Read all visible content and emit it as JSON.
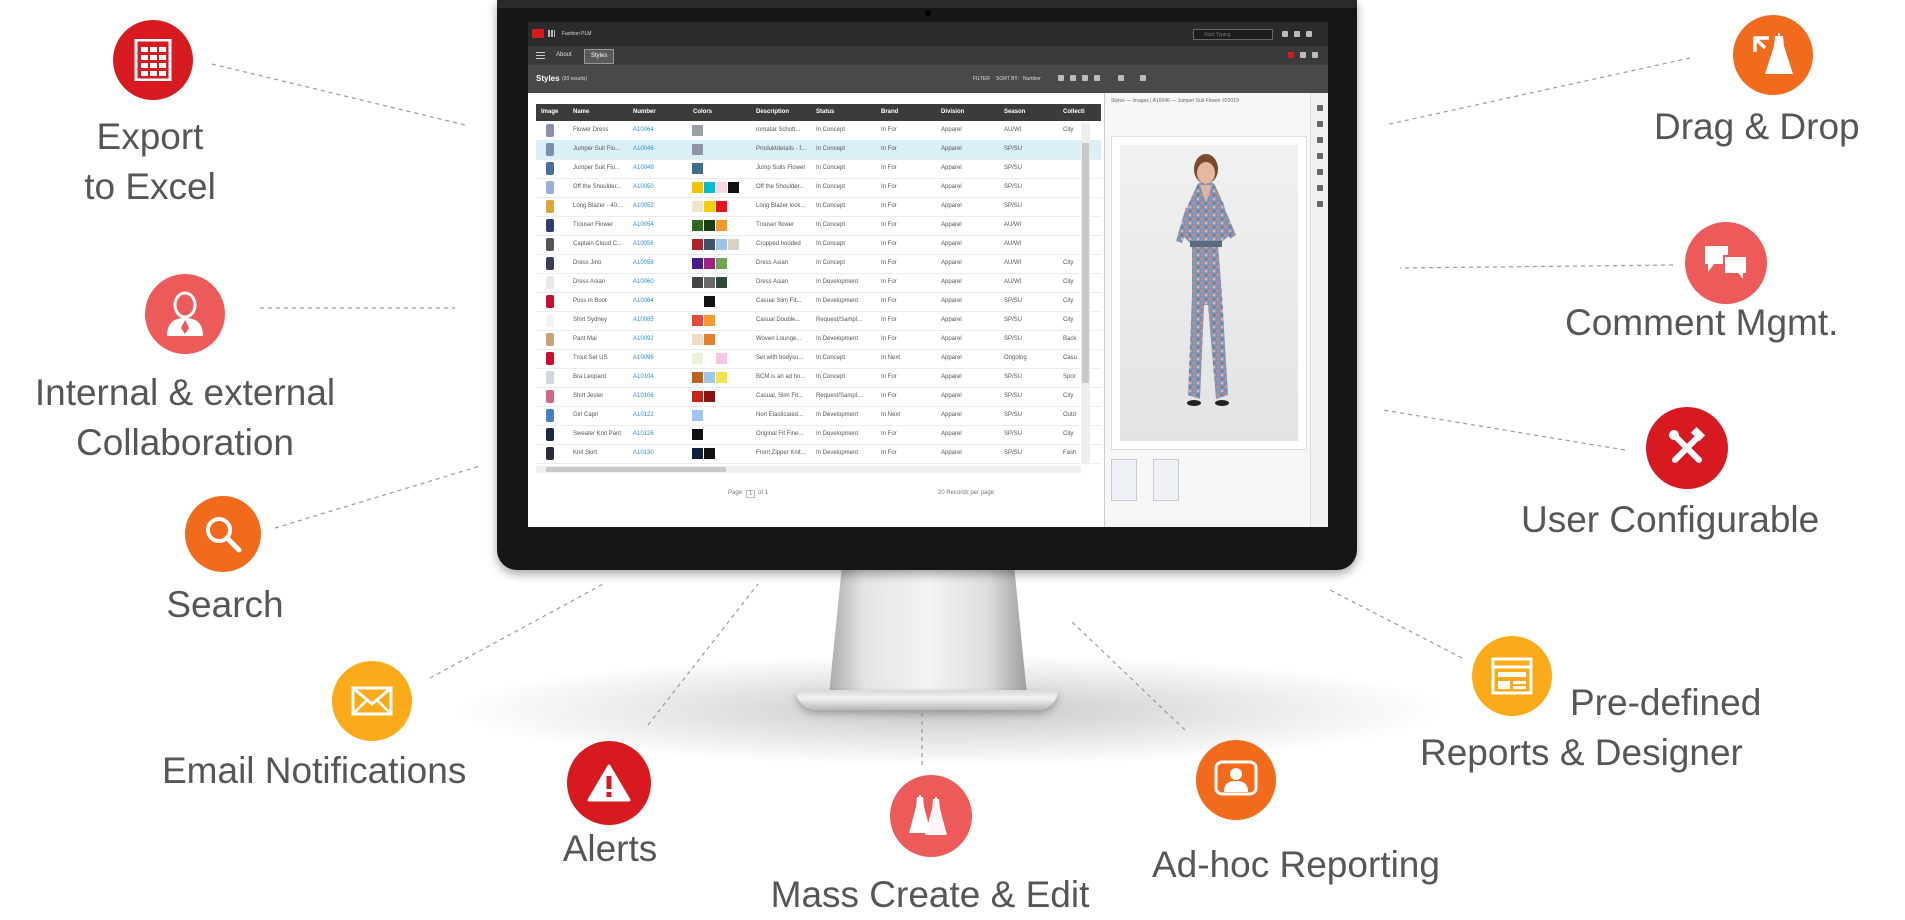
{
  "colors": {
    "red": "#d71920",
    "orange": "#f26a1b",
    "coral": "#ec5a5a",
    "amber": "#fbaa1a",
    "label_text": "#565656",
    "link_blue": "#2a8fd3"
  },
  "features": {
    "export": {
      "line1": "Export",
      "line2": "to Excel",
      "icon": "spreadsheet-icon"
    },
    "collab": {
      "line1": "Internal & external",
      "line2": "Collaboration",
      "icon": "user-icon"
    },
    "search": {
      "label": "Search",
      "icon": "magnifier-icon"
    },
    "email": {
      "label": "Email Notifications",
      "icon": "envelope-icon"
    },
    "alerts": {
      "label": "Alerts",
      "icon": "warning-icon"
    },
    "mass": {
      "label": "Mass Create & Edit",
      "icon": "dresses-icon"
    },
    "adhoc": {
      "label": "Ad-hoc Reporting",
      "icon": "report-person-icon"
    },
    "reports": {
      "line1": "Pre-defined",
      "line2": "Reports & Designer",
      "icon": "browser-report-icon"
    },
    "config": {
      "label": "User Configurable",
      "icon": "tools-icon"
    },
    "comment": {
      "label": "Comment Mgmt.",
      "icon": "chat-bubbles-icon"
    },
    "drag": {
      "label": "Drag & Drop",
      "icon": "drag-dress-icon"
    }
  },
  "app": {
    "name": "Fashion PLM",
    "search_placeholder": "Start Typing",
    "tabs": [
      "About",
      "Styles"
    ],
    "page_title": "Styles",
    "page_subtitle": "(20 results)",
    "filter_label": "FILTER",
    "sort_label": "SORT BY:",
    "sort_value": "Number",
    "columns": [
      "Image",
      "Name",
      "Number",
      "Colors",
      "Description",
      "Status",
      "Brand",
      "Division",
      "Season",
      "Collecti"
    ],
    "rows": [
      {
        "name": "Flower Dress",
        "number": "A10064",
        "desc": "romatar Schott...",
        "status": "In Concept",
        "brand": "In For",
        "division": "Apparel",
        "season": "AU/WI",
        "coll": "City",
        "thumb": "#8a8fa8",
        "swatches": [
          "#9aa0a8"
        ]
      },
      {
        "name": "Jumper Suit Flo...",
        "number": "A10046",
        "desc": "Produktdetails - f...",
        "status": "In Concept",
        "brand": "In For",
        "division": "Apparel",
        "season": "SP/SU",
        "coll": "",
        "thumb": "#7c8fb0",
        "swatches": [
          "#8c96a4"
        ]
      },
      {
        "name": "Jumper Suit Flo...",
        "number": "A10049",
        "desc": "Jump Suits Flower",
        "status": "In Concept",
        "brand": "In For",
        "division": "Apparel",
        "season": "SP/SU",
        "coll": "",
        "thumb": "#4a6e9c",
        "swatches": [
          "#3d6d8f"
        ]
      },
      {
        "name": "Off the Shoulder...",
        "number": "A10050",
        "desc": "Off the Shoulder...",
        "status": "In Concept",
        "brand": "In For",
        "division": "Apparel",
        "season": "SP/SU",
        "coll": "",
        "thumb": "#9ab0d6",
        "swatches": [
          "#f2c400",
          "#00bcd4",
          "#f5d7e0",
          "#111111"
        ]
      },
      {
        "name": "Long Blazer - 40...",
        "number": "A10052",
        "desc": "Long Blazer lock...",
        "status": "In Concept",
        "brand": "In For",
        "division": "Apparel",
        "season": "SP/SU",
        "coll": "",
        "thumb": "#e0a43c",
        "swatches": [
          "#f3e4c8",
          "#f6cf00",
          "#e8141c"
        ]
      },
      {
        "name": "Trouser Flower",
        "number": "A10054",
        "desc": "Trouser flower",
        "status": "In Concept",
        "brand": "In For",
        "division": "Apparel",
        "season": "AU/WI",
        "coll": "",
        "thumb": "#2c3e70",
        "swatches": [
          "#2f6b1e",
          "#173d10",
          "#f39a2e"
        ]
      },
      {
        "name": "Captain Cloud C...",
        "number": "A10056",
        "desc": "Cropped hooded",
        "status": "In Concept",
        "brand": "In For",
        "division": "Apparel",
        "season": "AU/WI",
        "coll": "",
        "thumb": "#555555",
        "swatches": [
          "#b0222a",
          "#40506c",
          "#9cc2e8",
          "#d8d2c4"
        ]
      },
      {
        "name": "Dress Jino",
        "number": "A10058",
        "desc": "Dress Asian",
        "status": "In Concept",
        "brand": "In For",
        "division": "Apparel",
        "season": "AU/WI",
        "coll": "City",
        "thumb": "#3b3b5c",
        "swatches": [
          "#4b1b8c",
          "#a0247a",
          "#6aa84f"
        ]
      },
      {
        "name": "Dress Asian",
        "number": "A10060",
        "desc": "Dress Asian",
        "status": "In Development",
        "brand": "In For",
        "division": "Apparel",
        "season": "AU/WI",
        "coll": "City",
        "thumb": "#e8e8e8",
        "swatches": [
          "#444444",
          "#6a6a6a",
          "#2d4a3a"
        ]
      },
      {
        "name": "Puss in Boot",
        "number": "A10064",
        "desc": "Casual Slim Fit...",
        "status": "In Development",
        "brand": "In For",
        "division": "Apparel",
        "season": "SP/SU",
        "coll": "City",
        "thumb": "#c8102e",
        "swatches": [
          "#ffffff",
          "#111111"
        ]
      },
      {
        "name": "Shirt Sydney",
        "number": "A10085",
        "desc": "Casual Double...",
        "status": "Request/Sampl...",
        "brand": "In For",
        "division": "Apparel",
        "season": "SP/SU",
        "coll": "City",
        "thumb": "#f3f3f3",
        "swatches": [
          "#e64a3b",
          "#f39a2e"
        ]
      },
      {
        "name": "Pant Mai",
        "number": "A10092",
        "desc": "Woven Lounge...",
        "status": "In Development",
        "brand": "In For",
        "division": "Apparel",
        "season": "SP/SU",
        "coll": "Back",
        "thumb": "#c9a27a",
        "swatches": [
          "#f2dcc6",
          "#e87f2e"
        ]
      },
      {
        "name": "Trout Set US",
        "number": "A10096",
        "desc": "Set with bodysu...",
        "status": "In Concept",
        "brand": "In Next",
        "division": "Apparel",
        "season": "Ongoing",
        "coll": "Casu",
        "thumb": "#c8102e",
        "swatches": [
          "#e8f4d8",
          "#ffffff",
          "#f6c4e4"
        ]
      },
      {
        "name": "Bra Leopard",
        "number": "A10104",
        "desc": "BCM is an ad ho...",
        "status": "In Concept",
        "brand": "In For",
        "division": "Apparel",
        "season": "SP/SU",
        "coll": "Spor",
        "thumb": "#cfd6e0",
        "swatches": [
          "#c0621c",
          "#9ac8e6",
          "#f4e24c"
        ]
      },
      {
        "name": "Shirt Jester",
        "number": "A10106",
        "desc": "Casual, Slim Fit...",
        "status": "Request/Sampl...",
        "brand": "In For",
        "division": "Apparel",
        "season": "SP/SU",
        "coll": "City",
        "thumb": "#d06a8a",
        "swatches": [
          "#c8241c",
          "#8a1410"
        ]
      },
      {
        "name": "Girl Capri",
        "number": "A10122",
        "desc": "Non Elasticated...",
        "status": "In Development",
        "brand": "In Next",
        "division": "Apparel",
        "season": "SP/SU",
        "coll": "Outd",
        "thumb": "#4a7cc6",
        "swatches": [
          "#9cc6ee",
          "#ffffff"
        ]
      },
      {
        "name": "Sweater Knit Pant",
        "number": "A10126",
        "desc": "Original Fit Fine...",
        "status": "In Development",
        "brand": "In For",
        "division": "Apparel",
        "season": "SP/SU",
        "coll": "City",
        "thumb": "#1c2a44",
        "swatches": [
          "#111111"
        ]
      },
      {
        "name": "Knit Skirt",
        "number": "A10130",
        "desc": "Front Zipper Knit...",
        "status": "In Development",
        "brand": "In For",
        "division": "Apparel",
        "season": "SP/SU",
        "coll": "Fash",
        "thumb": "#2a2a3a",
        "swatches": [
          "#0c2140",
          "#111111"
        ]
      }
    ],
    "pager": {
      "page_label": "Page",
      "page_value": "1",
      "of_label": "of 1",
      "per_page": "20 Records per page"
    },
    "panel_title": "Styles — Images | A10046 — Jumper Suit Flower #22019"
  }
}
